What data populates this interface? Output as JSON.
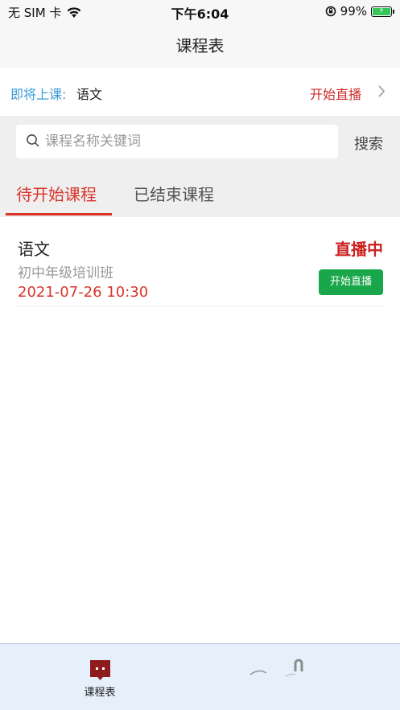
{
  "status_bar": {
    "carrier": "无 SIM 卡",
    "time": "下午6:04",
    "battery": "99%"
  },
  "nav": {
    "title": "课程表"
  },
  "upcoming": {
    "label": "即将上课:",
    "subject": "语文",
    "action": "开始直播"
  },
  "search": {
    "placeholder": "课程名称关键词",
    "value": "",
    "button_label": "搜索"
  },
  "tabs": [
    {
      "label": "待开始课程",
      "active": true
    },
    {
      "label": "已结束课程",
      "active": false
    }
  ],
  "courses": [
    {
      "name": "语文",
      "class_name": "初中年级培训班",
      "datetime": "2021-07-26 10:30",
      "status": "直播中",
      "action_label": "开始直播"
    }
  ],
  "tab_bar": {
    "items": [
      {
        "label": "课程表",
        "icon": "schedule-icon"
      },
      {
        "label": "",
        "icon": "profile-icon"
      }
    ]
  },
  "colors": {
    "accent_red": "#d9342b",
    "link_blue": "#3d9bd8",
    "live_green": "#1aa64a",
    "tabbar_bg": "#e6f0fb"
  }
}
